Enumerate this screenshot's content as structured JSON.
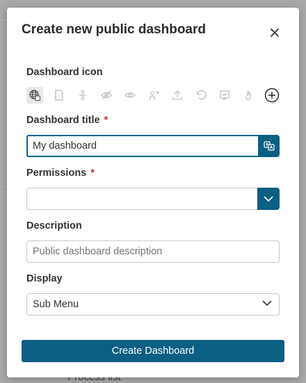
{
  "backdrop": {
    "behind_text": "Process list"
  },
  "modal": {
    "title": "Create new public dashboard",
    "close_icon": "close-icon"
  },
  "icon_field": {
    "label": "Dashboard icon",
    "icons": [
      "globe-translate-icon",
      "document-icon",
      "network-icon",
      "eye-off-icon",
      "eye-icon",
      "share-user-icon",
      "upload-icon",
      "undo-icon",
      "presentation-icon",
      "touch-icon",
      "add-circle-icon"
    ],
    "selected": "globe-translate-icon"
  },
  "title_field": {
    "label": "Dashboard title",
    "required_mark": "*",
    "value": "My dashboard",
    "addon_icon": "translate-icon"
  },
  "permissions_field": {
    "label": "Permissions",
    "required_mark": "*",
    "value": "",
    "addon_icon": "chevron-down-icon"
  },
  "description_field": {
    "label": "Description",
    "placeholder": "Public dashboard description"
  },
  "display_field": {
    "label": "Display",
    "value": "Sub Menu"
  },
  "actions": {
    "create_label": "Create Dashboard"
  },
  "colors": {
    "accent": "#0b5f82",
    "required": "#c0312b"
  }
}
